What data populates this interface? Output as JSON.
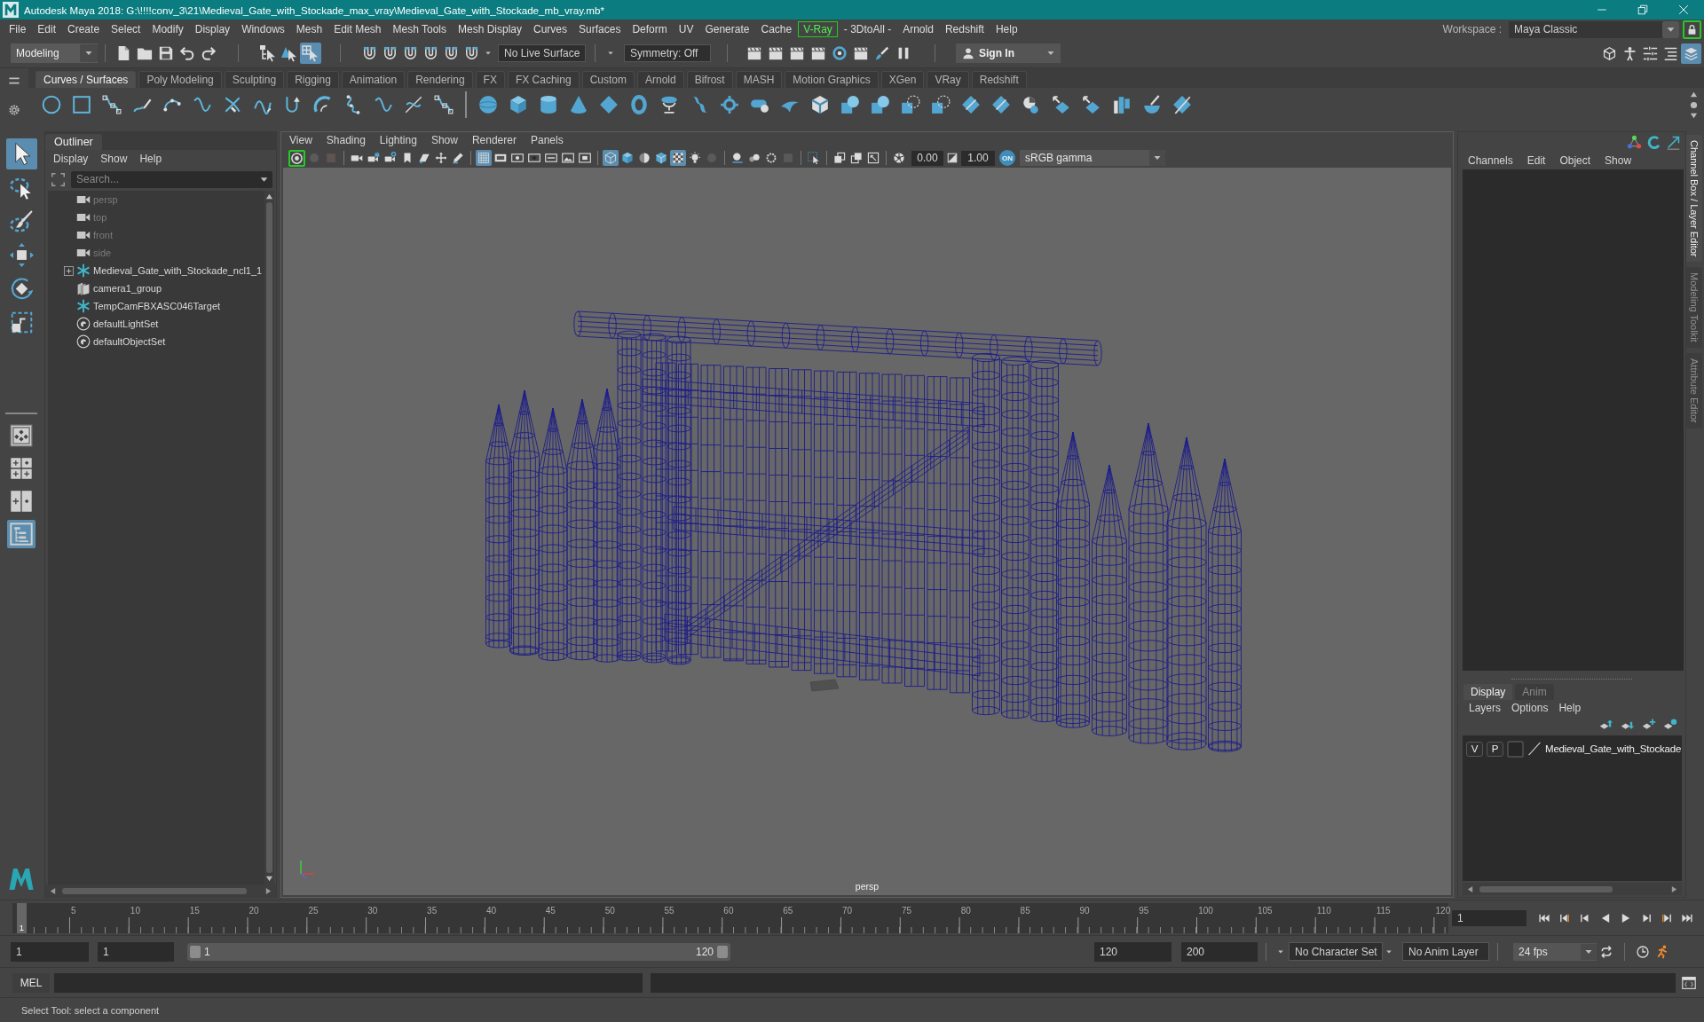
{
  "window": {
    "title": "Autodesk Maya 2018: G:\\!!!!conv_3\\21\\Medieval_Gate_with_Stockade_max_vray\\Medieval_Gate_with_Stockade_mb_vray.mb*"
  },
  "menu_bar": {
    "items": [
      {
        "label": "File",
        "highlighted": false
      },
      {
        "label": "Edit",
        "highlighted": false
      },
      {
        "label": "Create",
        "highlighted": false
      },
      {
        "label": "Select",
        "highlighted": false
      },
      {
        "label": "Modify",
        "highlighted": false
      },
      {
        "label": "Display",
        "highlighted": false
      },
      {
        "label": "Windows",
        "highlighted": false
      },
      {
        "label": "Mesh",
        "highlighted": false
      },
      {
        "label": "Edit Mesh",
        "highlighted": false
      },
      {
        "label": "Mesh Tools",
        "highlighted": false
      },
      {
        "label": "Mesh Display",
        "highlighted": false
      },
      {
        "label": "Curves",
        "highlighted": false
      },
      {
        "label": "Surfaces",
        "highlighted": false
      },
      {
        "label": "Deform",
        "highlighted": false
      },
      {
        "label": "UV",
        "highlighted": false
      },
      {
        "label": "Generate",
        "highlighted": false
      },
      {
        "label": "Cache",
        "highlighted": false
      },
      {
        "label": "V-Ray",
        "highlighted": true
      },
      {
        "label": "- 3DtoAll -",
        "highlighted": false
      },
      {
        "label": "Arnold",
        "highlighted": false
      },
      {
        "label": "Redshift",
        "highlighted": false
      },
      {
        "label": "Help",
        "highlighted": false
      }
    ],
    "workspace_label": "Workspace :",
    "workspace": "Maya Classic",
    "lock_highlighted": true
  },
  "status_line": {
    "mode": "Modeling",
    "selection_modes": [
      {
        "selected": false
      },
      {
        "selected": false
      },
      {
        "selected": true
      }
    ],
    "live_surface": "No Live Surface",
    "symmetry": "Symmetry: Off",
    "sign_in": "Sign In",
    "panel_toggles": [
      {
        "on": false
      },
      {
        "on": false
      },
      {
        "on": false
      },
      {
        "on": false
      },
      {
        "on": true
      }
    ]
  },
  "shelf": {
    "tabs": [
      {
        "label": "Curves / Surfaces",
        "selected": true
      },
      {
        "label": "Poly Modeling",
        "selected": false
      },
      {
        "label": "Sculpting",
        "selected": false
      },
      {
        "label": "Rigging",
        "selected": false
      },
      {
        "label": "Animation",
        "selected": false
      },
      {
        "label": "Rendering",
        "selected": false
      },
      {
        "label": "FX",
        "selected": false
      },
      {
        "label": "FX Caching",
        "selected": false
      },
      {
        "label": "Custom",
        "selected": false
      },
      {
        "label": "Arnold",
        "selected": false
      },
      {
        "label": "Bifrost",
        "selected": false
      },
      {
        "label": "MASH",
        "selected": false
      },
      {
        "label": "Motion Graphics",
        "selected": false
      },
      {
        "label": "XGen",
        "selected": false
      },
      {
        "label": "VRay",
        "selected": false
      },
      {
        "label": "Redshift",
        "selected": false
      }
    ]
  },
  "toolbox": {
    "tools": [
      {
        "selected": true
      },
      {
        "selected": false
      },
      {
        "selected": false
      },
      {
        "selected": false
      },
      {
        "selected": false
      },
      {
        "selected": false
      }
    ],
    "layouts": [
      {
        "selected": false
      },
      {
        "selected": false
      },
      {
        "selected": false
      },
      {
        "selected": true
      }
    ]
  },
  "outliner": {
    "title": "Outliner",
    "menu": [
      "Display",
      "Show",
      "Help"
    ],
    "search": {
      "placeholder": "Search..."
    },
    "items": [
      {
        "label": "persp",
        "kind": "camera",
        "dimmed": true
      },
      {
        "label": "top",
        "kind": "camera",
        "dimmed": true
      },
      {
        "label": "front",
        "kind": "camera",
        "dimmed": true
      },
      {
        "label": "side",
        "kind": "camera",
        "dimmed": true
      },
      {
        "label": "Medieval_Gate_with_Stockade_ncl1_1",
        "kind": "transform",
        "dimmed": false,
        "expanded": false
      },
      {
        "label": "camera1_group",
        "kind": "group",
        "dimmed": false
      },
      {
        "label": "TempCamFBXASC046Target",
        "kind": "transform",
        "dimmed": false
      },
      {
        "label": "defaultLightSet",
        "kind": "set",
        "dimmed": false
      },
      {
        "label": "defaultObjectSet",
        "kind": "set",
        "dimmed": false
      }
    ]
  },
  "viewport": {
    "menu": [
      "View",
      "Shading",
      "Lighting",
      "Show",
      "Renderer",
      "Panels"
    ],
    "camera_button": {
      "highlighted": true
    },
    "buttons": [
      {
        "on": false
      },
      {
        "on": false
      },
      {
        "on": false
      },
      {
        "on": false
      },
      {
        "on": false
      },
      {
        "on": false
      },
      {
        "on": false
      },
      {
        "on": false
      },
      {
        "on": false
      },
      {
        "on": true
      },
      {
        "on": false
      },
      {
        "on": false
      },
      {
        "on": false
      },
      {
        "on": false
      },
      {
        "on": false
      },
      {
        "on": false
      },
      {
        "on": true
      },
      {
        "on": false
      },
      {
        "on": false
      },
      {
        "on": false
      },
      {
        "on": true
      },
      {
        "on": false
      },
      {
        "on": false
      },
      {
        "on": false
      },
      {
        "on": false
      },
      {
        "on": false
      },
      {
        "on": false
      },
      {
        "on": false
      },
      {
        "on": false
      },
      {
        "on": false
      },
      {
        "on": false
      },
      {
        "on": false
      }
    ],
    "near_value": "0.00",
    "gamma_value": "1.00",
    "color_toggle": "ON",
    "color_space": "sRGB gamma",
    "camera_label": "persp"
  },
  "channel_box": {
    "menu": [
      "Channels",
      "Edit",
      "Object",
      "Show"
    ]
  },
  "layer_editor": {
    "tabs": [
      {
        "label": "Display",
        "selected": true
      },
      {
        "label": "Anim",
        "selected": false
      }
    ],
    "menu": [
      "Layers",
      "Options",
      "Help"
    ],
    "layers": [
      {
        "visibility": "V",
        "playback": "P",
        "name": "Medieval_Gate_with_Stockade"
      }
    ]
  },
  "side_tabs": [
    {
      "label": "Channel Box / Layer Editor",
      "selected": true
    },
    {
      "label": "Modeling Toolkit",
      "selected": false
    },
    {
      "label": "Attribute Editor",
      "selected": false
    }
  ],
  "time_slider": {
    "ticks": [
      "5",
      "10",
      "15",
      "20",
      "25",
      "30",
      "35",
      "40",
      "45",
      "50",
      "55",
      "60",
      "65",
      "70",
      "75",
      "80",
      "85",
      "90",
      "95",
      "100",
      "105",
      "110",
      "115",
      "120"
    ],
    "current_frame": "1",
    "level": 0,
    "frame_field": "1"
  },
  "range_slider": {
    "start": "1",
    "playback_start": "1",
    "range_start": "1",
    "range_end": "120",
    "level": 1,
    "playback_end": "120",
    "end": "200"
  },
  "playback_options": {
    "character_set": "No Character Set",
    "anim_layer": "No Anim Layer",
    "fps": "24 fps"
  },
  "command_line": {
    "language": "MEL"
  },
  "help_line": {
    "text": "Select Tool: select a component"
  }
}
